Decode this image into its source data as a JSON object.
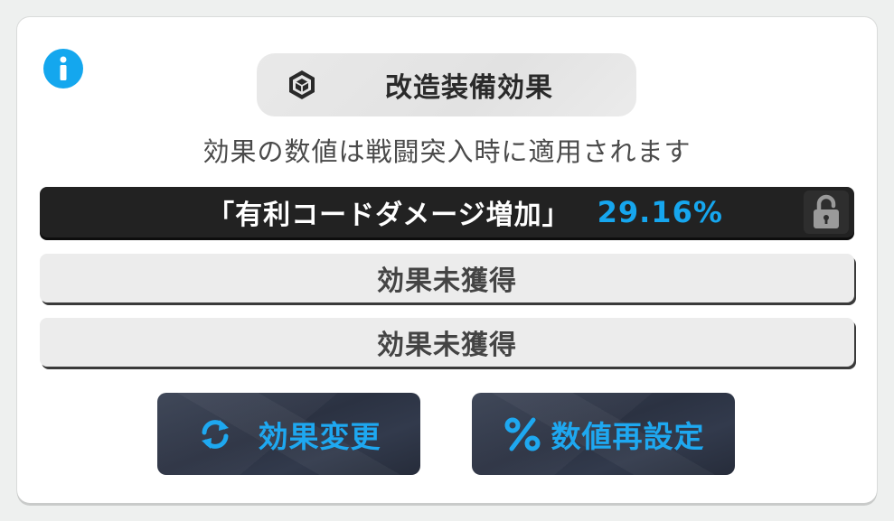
{
  "dialog": {
    "title": "改造装備効果",
    "subtitle": "効果の数値は戦闘突入時に適用されます"
  },
  "effects": [
    {
      "name": "「有利コードダメージ増加」",
      "value": "29.16%",
      "locked": false
    },
    {
      "label": "効果未獲得"
    },
    {
      "label": "効果未獲得"
    }
  ],
  "actions": {
    "change_label": "効果変更",
    "reroll_label": "数値再設定"
  },
  "colors": {
    "accent": "#16a6ee",
    "active_row": "#222222",
    "button_bg": "#2b3242"
  },
  "icons": {
    "info": "info-icon",
    "title": "hexagon-cube-icon",
    "lock": "unlock-icon",
    "change": "refresh-icon",
    "reroll": "percent-icon"
  }
}
